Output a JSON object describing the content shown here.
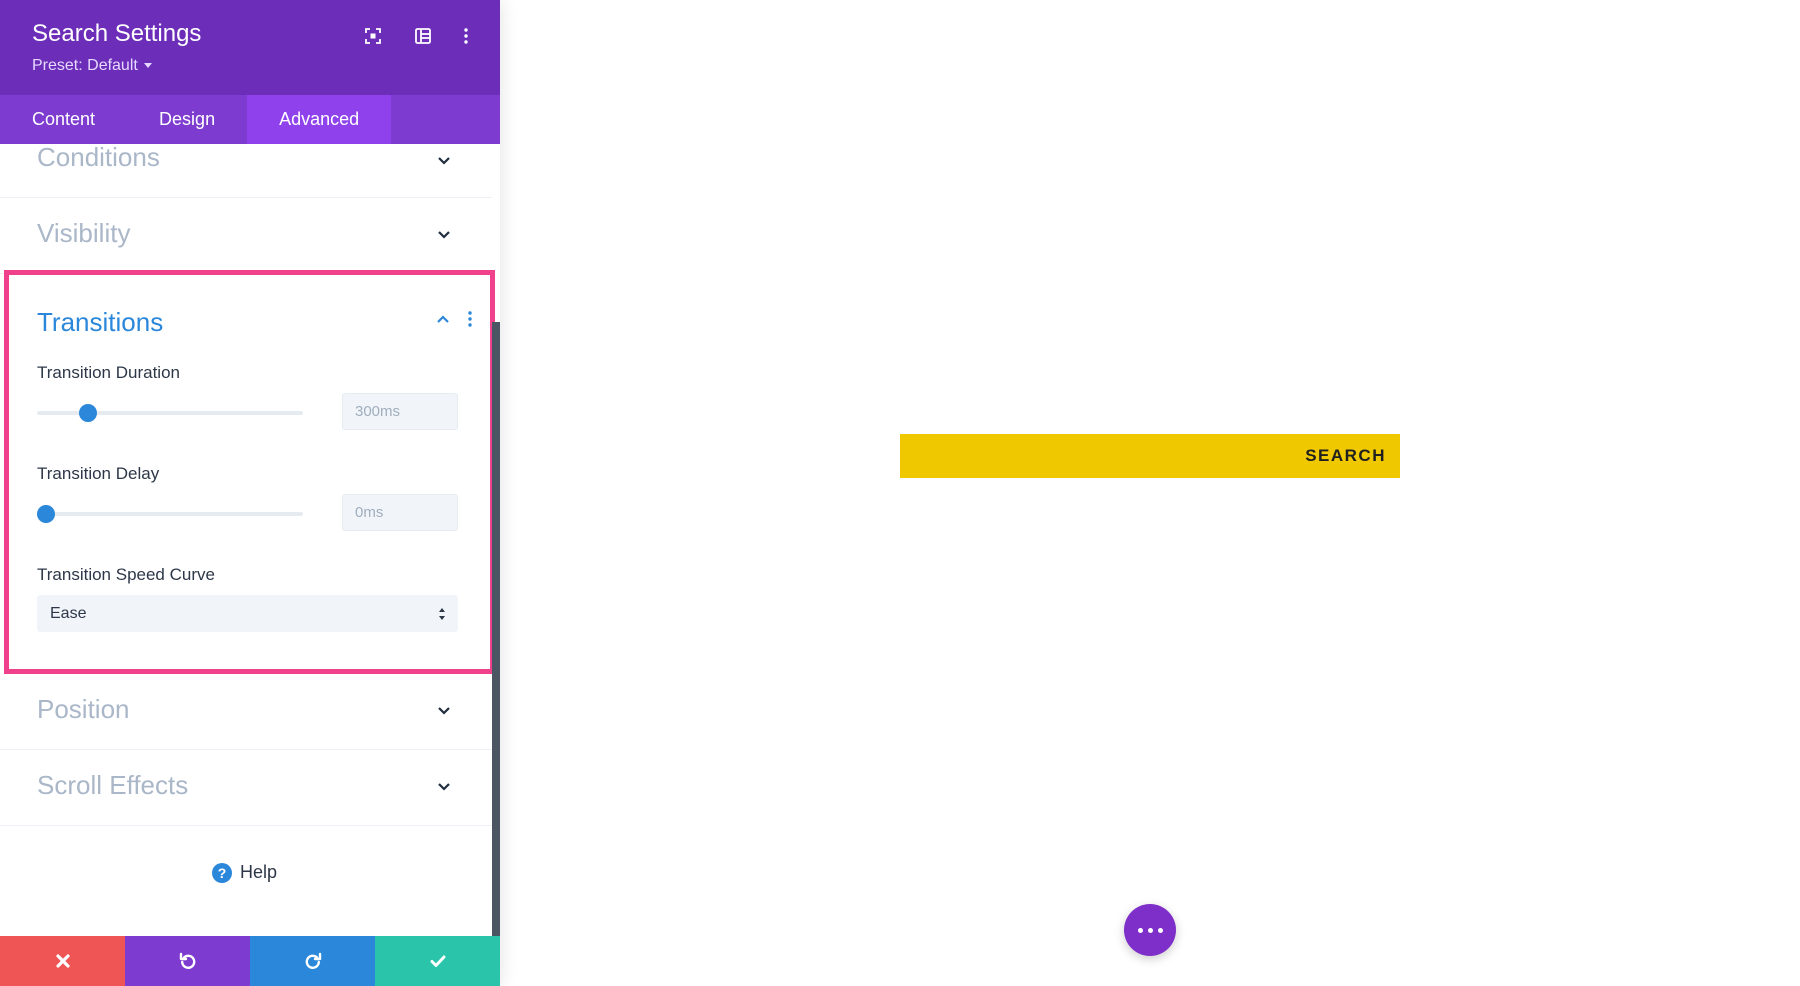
{
  "header": {
    "title": "Search Settings",
    "preset_label": "Preset: Default",
    "icons": [
      "focus-icon",
      "layout-icon",
      "more-vertical-icon"
    ]
  },
  "tabs": [
    {
      "label": "Content",
      "active": false
    },
    {
      "label": "Design",
      "active": false
    },
    {
      "label": "Advanced",
      "active": true
    }
  ],
  "sections": {
    "conditions": "Conditions",
    "visibility": "Visibility",
    "position": "Position",
    "scroll_effects": "Scroll Effects"
  },
  "transitions": {
    "title": "Transitions",
    "duration": {
      "label": "Transition Duration",
      "value": "300ms",
      "level": 0.17
    },
    "delay": {
      "label": "Transition Delay",
      "value": "0ms",
      "level": 0.0
    },
    "speed_curve": {
      "label": "Transition Speed Curve",
      "value": "Ease"
    }
  },
  "help": {
    "label": "Help",
    "icon": "?"
  },
  "footer": {
    "buttons": [
      {
        "name": "cancel",
        "icon": "close-icon",
        "color": "#ef5555"
      },
      {
        "name": "undo",
        "icon": "undo-icon",
        "color": "#7e3bd0"
      },
      {
        "name": "redo",
        "icon": "redo-icon",
        "color": "#2b87da"
      },
      {
        "name": "save",
        "icon": "check-icon",
        "color": "#29c4a9"
      }
    ]
  },
  "preview": {
    "search_button_label": "SEARCH",
    "search_bar_color": "#f0c800",
    "fab_color": "#7e2fc9"
  },
  "colors": {
    "header_bg": "#6c2eb9",
    "tabs_bg": "#7d3bcf",
    "active_tab_bg": "#8f42ec",
    "highlight_border": "#f0418c",
    "accent_blue": "#2b87da"
  }
}
